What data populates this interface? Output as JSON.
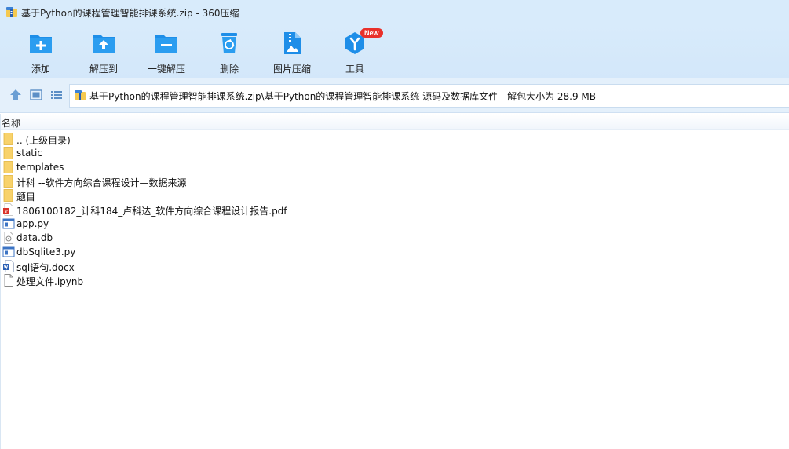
{
  "window": {
    "title": "基于Python的课程管理智能排课系统.zip - 360压缩"
  },
  "toolbar": {
    "items": [
      {
        "label": "添加",
        "icon": "add-archive-icon"
      },
      {
        "label": "解压到",
        "icon": "extract-to-icon"
      },
      {
        "label": "一键解压",
        "icon": "one-click-extract-icon"
      },
      {
        "label": "删除",
        "icon": "delete-icon"
      },
      {
        "label": "图片压缩",
        "icon": "image-compress-icon"
      },
      {
        "label": "工具",
        "icon": "tools-icon",
        "badge": "New"
      }
    ]
  },
  "address": {
    "path": "基于Python的课程管理智能排课系统.zip\\基于Python的课程管理智能排课系统 源码及数据库文件 - 解包大小为 28.9 MB"
  },
  "list": {
    "column_name": "名称",
    "rows": [
      {
        "name": ".. (上级目录)",
        "type": "folder"
      },
      {
        "name": "static",
        "type": "folder"
      },
      {
        "name": "templates",
        "type": "folder"
      },
      {
        "name": "计科 --软件方向综合课程设计—数据来源",
        "type": "folder"
      },
      {
        "name": "题目",
        "type": "folder"
      },
      {
        "name": "1806100182_计科184_卢科达_软件方向综合课程设计报告.pdf",
        "type": "pdf"
      },
      {
        "name": "app.py",
        "type": "py"
      },
      {
        "name": "data.db",
        "type": "db"
      },
      {
        "name": "dbSqlite3.py",
        "type": "py"
      },
      {
        "name": "sql语句.docx",
        "type": "docx"
      },
      {
        "name": "处理文件.ipynb",
        "type": "file"
      }
    ]
  },
  "colors": {
    "toolbar_bg": "#d8ebfb",
    "icon_blue": "#1e8ee8",
    "badge_red": "#e9302a",
    "folder_yellow": "#f8d26b"
  }
}
